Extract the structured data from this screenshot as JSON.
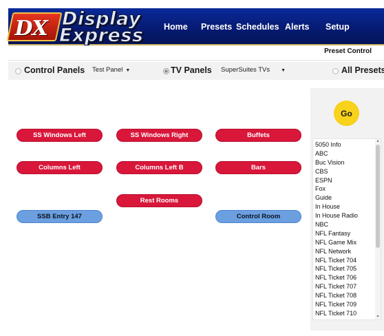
{
  "brand": {
    "logo_mark": "DX",
    "logo_line1": "Display",
    "logo_line2": "Express"
  },
  "nav": {
    "items": [
      {
        "label": "Home"
      },
      {
        "label": "Presets"
      },
      {
        "label": "Schedules"
      },
      {
        "label": "Alerts"
      },
      {
        "label": "Setup"
      }
    ]
  },
  "sub_header": {
    "preset_control": "Preset Control"
  },
  "selector": {
    "control_panels": {
      "label": "Control Panels",
      "checked": false,
      "dropdown_value": "Test Panel"
    },
    "tv_panels": {
      "label": "TV Panels",
      "checked": true,
      "dropdown_value": "SuperSuites TVs"
    },
    "all_presets": {
      "label": "All Presets",
      "checked": false
    }
  },
  "buttons": [
    {
      "label": "SS Windows Left",
      "color": "red"
    },
    {
      "label": "SS Windows Right",
      "color": "red"
    },
    {
      "label": "Buffets",
      "color": "red"
    },
    {
      "label": "Columns Left",
      "color": "red"
    },
    {
      "label": "Columns Left B",
      "color": "red"
    },
    {
      "label": "Bars",
      "color": "red"
    },
    {
      "label": "Rest Rooms",
      "color": "red"
    },
    {
      "label": "SSB Entry 147",
      "color": "blue"
    },
    {
      "label": "Control Room",
      "color": "blue"
    }
  ],
  "go_button": {
    "label": "Go"
  },
  "channels": [
    "5050 Info",
    "ABC",
    "Buc Vision",
    "CBS",
    "ESPN",
    "Fox",
    "Guide",
    "In House",
    "In House Radio",
    "NBC",
    "NFL Fantasy",
    "NFL Game Mix",
    "NFL Network",
    "NFL Ticket 704",
    "NFL Ticket 705",
    "NFL Ticket 706",
    "NFL Ticket 707",
    "NFL Ticket 708",
    "NFL Ticket 709",
    "NFL Ticket 710"
  ],
  "colors": {
    "header_bg": "#061b73",
    "red_button": "#d8173a",
    "blue_button": "#6b9fe0",
    "go_button": "#f8d21b"
  },
  "icons": {
    "dropdown_arrow": "caret-down-icon",
    "scroll_up": "scroll-up-icon",
    "scroll_down": "scroll-down-icon"
  }
}
